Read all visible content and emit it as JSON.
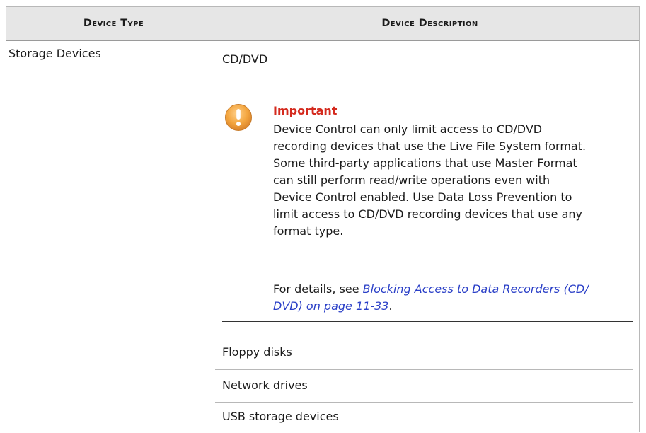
{
  "table": {
    "headers": {
      "device_type": "Device Type",
      "device_description": "Device Description"
    },
    "rows": [
      {
        "device_type": "Storage Devices",
        "descriptions": [
          "CD/DVD",
          "Floppy disks",
          "Network drives",
          "USB storage devices"
        ]
      }
    ]
  },
  "note": {
    "title": "Important",
    "icon": "exclamation-icon",
    "icon_color": "#f0a23a",
    "title_color": "#d42a1e",
    "body_lines": [
      "Device Control can only limit access to CD/DVD",
      "recording devices that use the Live File System format.",
      "Some third-party applications that use Master Format",
      "can still perform read/write operations even with",
      "Device Control enabled. Use Data Loss Prevention to",
      "limit access to CD/DVD recording devices that use any",
      "format type."
    ],
    "details_prefix": "For details, see ",
    "details_link_line1": "Blocking Access to Data Recorders (CD/",
    "details_link_line2": "DVD) on page 11-33",
    "details_suffix": ".",
    "link_color": "#2a3fc7"
  },
  "colors": {
    "header_bg": "#e6e6e6",
    "border": "#b8b8b8"
  }
}
